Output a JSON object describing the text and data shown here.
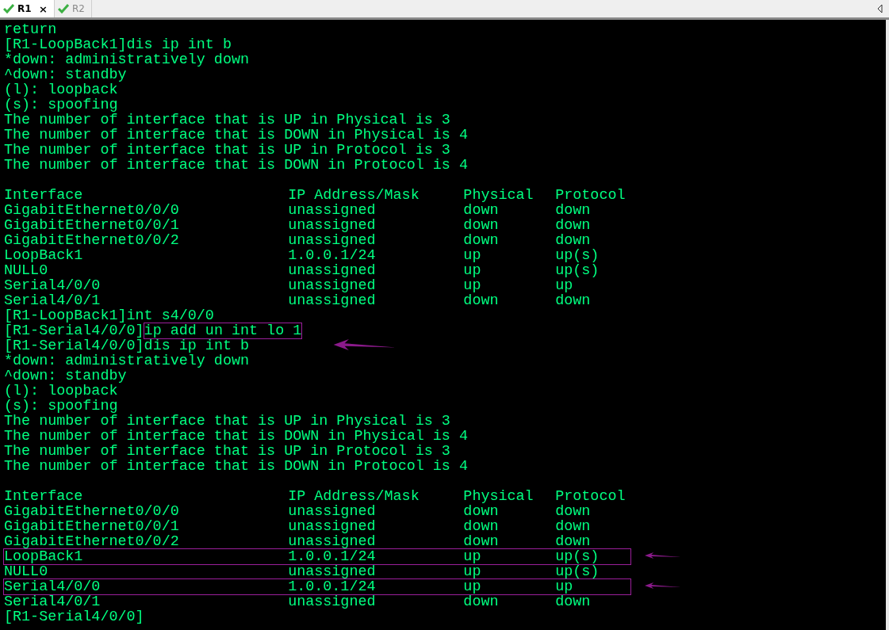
{
  "tabs": [
    {
      "label": "R1",
      "selected": true,
      "close": "×"
    },
    {
      "label": "R2",
      "selected": false
    }
  ],
  "terminal": {
    "lines": [
      {
        "kind": "text",
        "text": "return",
        "highlighted": false
      },
      {
        "kind": "command",
        "prompt": "[R1-LoopBack1]",
        "command": "dis ip int b",
        "highlighted": false
      },
      {
        "kind": "text",
        "text": "*down: administratively down",
        "highlighted": false
      },
      {
        "kind": "text",
        "text": "^down: standby",
        "highlighted": false
      },
      {
        "kind": "text",
        "text": "(l): loopback",
        "highlighted": false
      },
      {
        "kind": "text",
        "text": "(s): spoofing",
        "highlighted": false
      },
      {
        "kind": "text",
        "text": "The number of interface that is UP in Physical is 3",
        "highlighted": false
      },
      {
        "kind": "text",
        "text": "The number of interface that is DOWN in Physical is 4",
        "highlighted": false
      },
      {
        "kind": "text",
        "text": "The number of interface that is UP in Protocol is 3",
        "highlighted": false
      },
      {
        "kind": "text",
        "text": "The number of interface that is DOWN in Protocol is 4",
        "highlighted": false
      },
      {
        "kind": "blank"
      },
      {
        "kind": "header",
        "cells": [
          "Interface",
          "IP Address/Mask",
          "Physical",
          "Protocol"
        ],
        "highlighted": false
      },
      {
        "kind": "row",
        "cells": [
          "GigabitEthernet0/0/0",
          "unassigned",
          "down",
          "down"
        ],
        "highlighted": false
      },
      {
        "kind": "row",
        "cells": [
          "GigabitEthernet0/0/1",
          "unassigned",
          "down",
          "down"
        ],
        "highlighted": false
      },
      {
        "kind": "row",
        "cells": [
          "GigabitEthernet0/0/2",
          "unassigned",
          "down",
          "down"
        ],
        "highlighted": false
      },
      {
        "kind": "row",
        "cells": [
          "LoopBack1",
          "1.0.0.1/24",
          "up",
          "up(s)"
        ],
        "highlighted": false
      },
      {
        "kind": "row",
        "cells": [
          "NULL0",
          "unassigned",
          "up",
          "up(s)"
        ],
        "highlighted": false
      },
      {
        "kind": "row",
        "cells": [
          "Serial4/0/0",
          "unassigned",
          "up",
          "up"
        ],
        "highlighted": false
      },
      {
        "kind": "row",
        "cells": [
          "Serial4/0/1",
          "unassigned",
          "down",
          "down"
        ],
        "highlighted": false
      },
      {
        "kind": "command",
        "prompt": "[R1-LoopBack1]",
        "command": "int s4/0/0",
        "highlighted": false
      },
      {
        "kind": "command",
        "prompt": "[R1-Serial4/0/0]",
        "command": "ip add un int lo 1",
        "highlighted": true
      },
      {
        "kind": "command",
        "prompt": "[R1-Serial4/0/0]",
        "command": "dis ip int b",
        "highlighted": false
      },
      {
        "kind": "text",
        "text": "*down: administratively down",
        "highlighted": false
      },
      {
        "kind": "text",
        "text": "^down: standby",
        "highlighted": false
      },
      {
        "kind": "text",
        "text": "(l): loopback",
        "highlighted": false
      },
      {
        "kind": "text",
        "text": "(s): spoofing",
        "highlighted": false
      },
      {
        "kind": "text",
        "text": "The number of interface that is UP in Physical is 3",
        "highlighted": false
      },
      {
        "kind": "text",
        "text": "The number of interface that is DOWN in Physical is 4",
        "highlighted": false
      },
      {
        "kind": "text",
        "text": "The number of interface that is UP in Protocol is 3",
        "highlighted": false
      },
      {
        "kind": "text",
        "text": "The number of interface that is DOWN in Protocol is 4",
        "highlighted": false
      },
      {
        "kind": "blank"
      },
      {
        "kind": "header",
        "cells": [
          "Interface",
          "IP Address/Mask",
          "Physical",
          "Protocol"
        ],
        "highlighted": false
      },
      {
        "kind": "row",
        "cells": [
          "GigabitEthernet0/0/0",
          "unassigned",
          "down",
          "down"
        ],
        "highlighted": false
      },
      {
        "kind": "row",
        "cells": [
          "GigabitEthernet0/0/1",
          "unassigned",
          "down",
          "down"
        ],
        "highlighted": false
      },
      {
        "kind": "row",
        "cells": [
          "GigabitEthernet0/0/2",
          "unassigned",
          "down",
          "down"
        ],
        "highlighted": false
      },
      {
        "kind": "row",
        "cells": [
          "LoopBack1",
          "1.0.0.1/24",
          "up",
          "up(s)"
        ],
        "highlighted": true
      },
      {
        "kind": "row",
        "cells": [
          "NULL0",
          "unassigned",
          "up",
          "up(s)"
        ],
        "highlighted": false
      },
      {
        "kind": "row",
        "cells": [
          "Serial4/0/0",
          "1.0.0.1/24",
          "up",
          "up"
        ],
        "highlighted": true
      },
      {
        "kind": "row",
        "cells": [
          "Serial4/0/1",
          "unassigned",
          "down",
          "down"
        ],
        "highlighted": false
      },
      {
        "kind": "prompt",
        "prompt": "[R1-Serial4/0/0]"
      }
    ]
  }
}
